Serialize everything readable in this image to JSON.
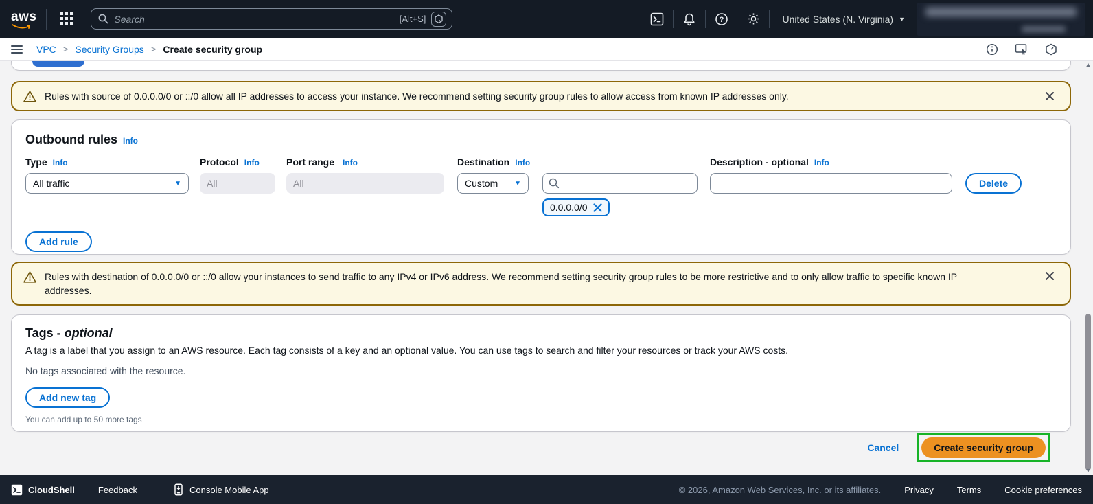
{
  "topbar": {
    "logo": "aws",
    "search_placeholder": "Search",
    "search_shortcut": "[Alt+S]",
    "region": "United States (N. Virginia)"
  },
  "breadcrumb": {
    "items": [
      "VPC",
      "Security Groups",
      "Create security group"
    ]
  },
  "banner_source": {
    "text": "Rules with source of 0.0.0.0/0 or ::/0 allow all IP addresses to access your instance. We recommend setting security group rules to allow access from known IP addresses only."
  },
  "outbound": {
    "title": "Outbound rules",
    "info_label": "Info",
    "columns": {
      "type": "Type",
      "protocol": "Protocol",
      "port_range": "Port range",
      "destination": "Destination",
      "description": "Description - optional"
    },
    "rule": {
      "type_value": "All traffic",
      "protocol_value": "All",
      "port_range_value": "All",
      "destination_mode": "Custom",
      "destination_chip": "0.0.0.0/0",
      "description_value": ""
    },
    "delete_label": "Delete",
    "add_rule_label": "Add rule"
  },
  "banner_destination": {
    "text": "Rules with destination of 0.0.0.0/0 or ::/0 allow your instances to send traffic to any IPv4 or IPv6 address. We recommend setting security group rules to be more restrictive and to only allow traffic to specific known IP addresses."
  },
  "tags": {
    "title": "Tags - ",
    "optional_label": "optional",
    "description": "A tag is a label that you assign to an AWS resource. Each tag consists of a key and an optional value. You can use tags to search and filter your resources or track your AWS costs.",
    "empty_text": "No tags associated with the resource.",
    "add_button": "Add new tag",
    "limit_text": "You can add up to 50 more tags"
  },
  "actions": {
    "cancel": "Cancel",
    "create": "Create security group"
  },
  "footer": {
    "cloudshell": "CloudShell",
    "feedback": "Feedback",
    "mobile_app": "Console Mobile App",
    "copyright": "© 2026, Amazon Web Services, Inc. or its affiliates.",
    "privacy": "Privacy",
    "terms": "Terms",
    "cookies": "Cookie preferences"
  },
  "colors": {
    "accent_blue": "#0972d3",
    "warning_border": "#8d6708",
    "warning_bg": "#fcf8e3",
    "primary_orange": "#ec9121",
    "annotation_green": "#17b327",
    "nav_dark": "#141b25"
  }
}
